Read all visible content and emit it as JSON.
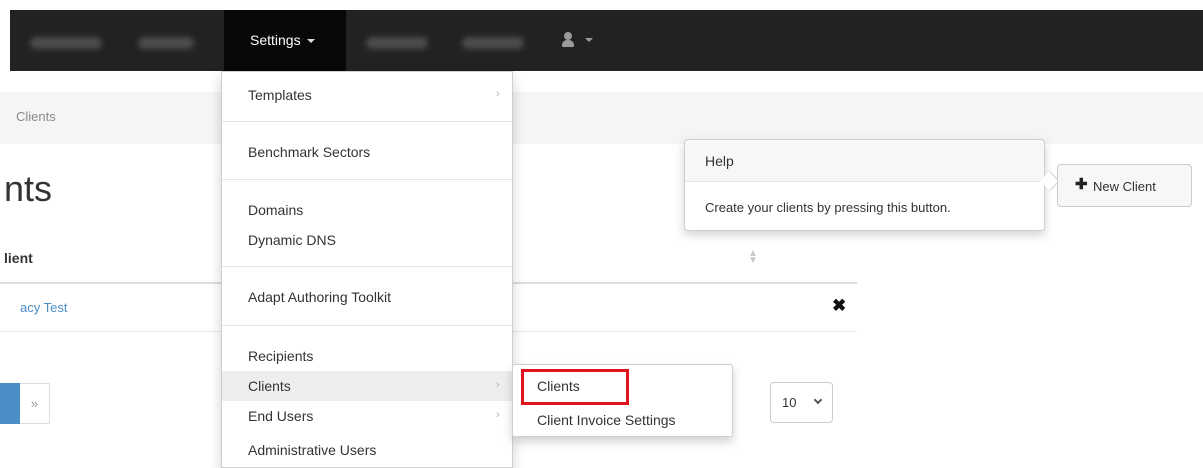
{
  "navbar": {
    "settings_label": "Settings"
  },
  "breadcrumb": {
    "current": "Clients"
  },
  "page": {
    "title_partial": "nts",
    "table_header": "lient",
    "client_row_link": "acy Test",
    "pager_next": "»",
    "page_size": "10"
  },
  "dropdown": {
    "items": [
      {
        "label": "Templates"
      },
      {
        "label": "Benchmark Sectors"
      },
      {
        "label": "Domains"
      },
      {
        "label": "Dynamic DNS"
      },
      {
        "label": "Adapt Authoring Toolkit"
      },
      {
        "label": "Recipients"
      },
      {
        "label": "Clients"
      },
      {
        "label": "End Users"
      },
      {
        "label": "Administrative Users"
      }
    ],
    "submenu": {
      "items": [
        {
          "label": "Clients"
        },
        {
          "label": "Client Invoice Settings"
        }
      ]
    }
  },
  "help_popover": {
    "title": "Help",
    "content": "Create your clients by pressing this button."
  },
  "new_client_button": {
    "label": "New Client"
  },
  "icons": {
    "user": "user-icon",
    "delete": "close-icon",
    "plus": "plus-icon",
    "submenu_arrow": "chevron-right-icon",
    "sort": "sort-icon"
  },
  "colors": {
    "navbar": "#222222",
    "link": "#4a8ec7",
    "highlight": "#e0141c"
  }
}
